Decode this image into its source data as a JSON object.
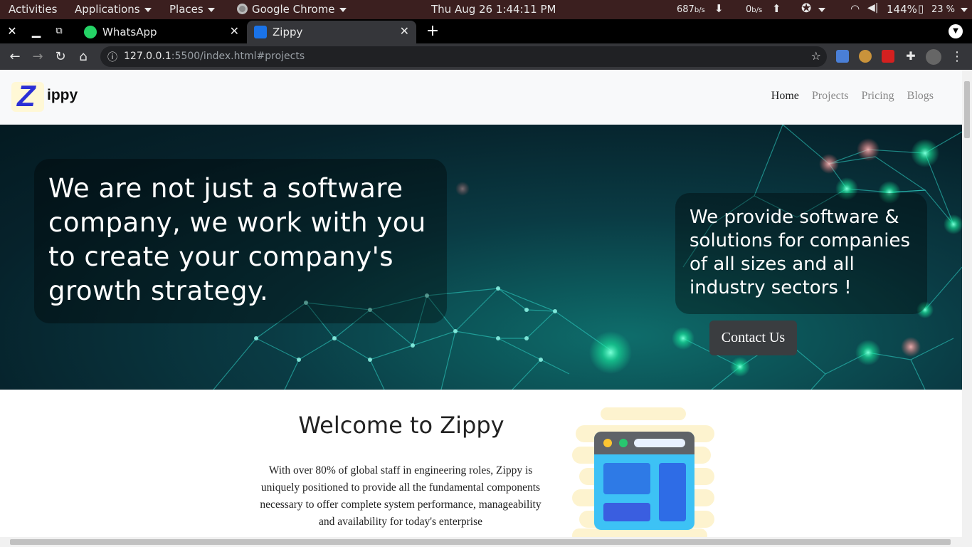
{
  "topbar": {
    "activities": "Activities",
    "applications": "Applications",
    "places": "Places",
    "app": "Google Chrome",
    "clock": "Thu Aug 26   1:44:11 PM",
    "down_speed": "687",
    "down_unit": "b/s",
    "up_speed": "0",
    "up_unit": "b/s",
    "volume": "144%",
    "battery": "23 %"
  },
  "tabs": [
    {
      "label": "WhatsApp",
      "icon": "whatsapp-icon"
    },
    {
      "label": "Zippy",
      "icon": "zippy-favicon"
    }
  ],
  "address": {
    "host": "127.0.0.1",
    "path": ":5500/index.html#projects"
  },
  "site": {
    "logo_letter": "Z",
    "logo_rest": "ippy",
    "nav": [
      "Home",
      "Projects",
      "Pricing",
      "Blogs"
    ],
    "hero_title": "We are not just a software company, we work with you to create your company's growth strategy.",
    "hero_subtitle": "We provide software & solutions for companies of all sizes and all industry sectors !",
    "contact_button": "Contact Us",
    "welcome_title": "Welcome to Zippy",
    "welcome_text": "With over 80% of global staff in engineering roles, Zippy is uniquely positioned to provide all the fundamental components necessary to offer complete system performance, manageability and availability for today's enterprise"
  },
  "colors": {
    "topbar_bg": "#3b1f1f",
    "tabstrip_bg": "#000000",
    "toolbar_bg": "#35363a",
    "hero_accent": "#19f0c0",
    "logo_blue": "#2b2fd6"
  }
}
